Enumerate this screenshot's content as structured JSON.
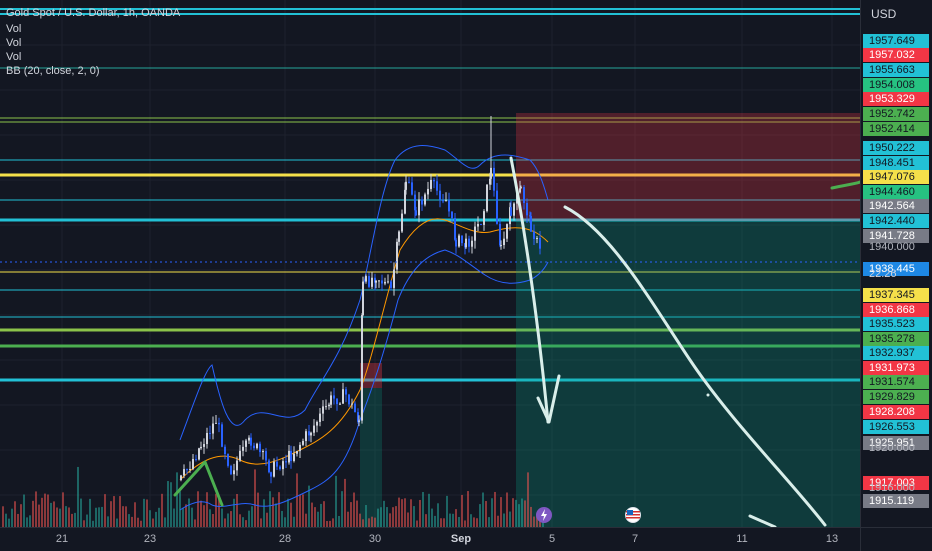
{
  "legend": {
    "title": "Gold Spot / U.S. Dollar, 1h, OANDA",
    "vol1": "Vol",
    "vol2": "Vol",
    "vol3": "Vol",
    "bb": "BB (20, close, 2, 0)"
  },
  "axis": {
    "currency": "USD",
    "plain_labels": [
      "1940.000",
      "1920.000",
      "1916.000"
    ],
    "countdown": "22:26",
    "tags": [
      {
        "price": "1957.649",
        "color": "#22c1d6"
      },
      {
        "price": "1957.032",
        "color": "#f23645"
      },
      {
        "price": "1955.663",
        "color": "#22c1d6"
      },
      {
        "price": "1954.008",
        "color": "#26c281"
      },
      {
        "price": "1953.329",
        "color": "#f23645"
      },
      {
        "price": "1952.742",
        "color": "#4caf50"
      },
      {
        "price": "1952.414",
        "color": "#4caf50"
      },
      {
        "price": "1950.222",
        "color": "#22c1d6"
      },
      {
        "price": "1948.451",
        "color": "#22c1d6"
      },
      {
        "price": "1947.076",
        "color": "#f5e04a"
      },
      {
        "price": "1944.460",
        "color": "#26c281"
      },
      {
        "price": "1942.564",
        "color": "#787b86"
      },
      {
        "price": "1942.440",
        "color": "#22c1d6"
      },
      {
        "price": "1941.728",
        "color": "#787b86"
      },
      {
        "price": "1938.445",
        "color": "#1e88e5"
      },
      {
        "price": "1937.345",
        "color": "#f5e04a"
      },
      {
        "price": "1936.868",
        "color": "#f23645"
      },
      {
        "price": "1935.523",
        "color": "#22c1d6"
      },
      {
        "price": "1935.278",
        "color": "#4caf50"
      },
      {
        "price": "1932.937",
        "color": "#22c1d6"
      },
      {
        "price": "1931.973",
        "color": "#f23645"
      },
      {
        "price": "1931.574",
        "color": "#4caf50"
      },
      {
        "price": "1929.829",
        "color": "#4caf50"
      },
      {
        "price": "1928.208",
        "color": "#f23645"
      },
      {
        "price": "1926.553",
        "color": "#22c1d6"
      },
      {
        "price": "1925.951",
        "color": "#787b86"
      },
      {
        "price": "1917.003",
        "color": "#f23645"
      },
      {
        "price": "1915.119",
        "color": "#787b86"
      }
    ]
  },
  "time_axis": {
    "labels": [
      "21",
      "23",
      "28",
      "30",
      "Sep",
      "5",
      "7",
      "11",
      "13"
    ]
  },
  "colors": {
    "background": "#131722",
    "up": "#d1d4dc",
    "down": "#2962ff",
    "short_loss_zone": "#f23645",
    "short_profit_zone": "#089981"
  },
  "icons": {
    "event1": "lightning-icon",
    "event2": "us-flag-icon"
  }
}
